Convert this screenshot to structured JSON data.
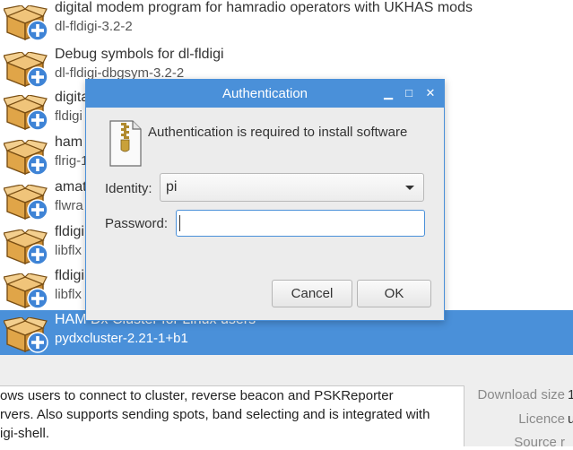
{
  "packages": [
    {
      "name": "digital modem program for hamradio operators with UKHAS mods",
      "id": "dl-fldigi-3.2-2",
      "selected": false
    },
    {
      "name": "Debug symbols for dl-fldigi",
      "id": "dl-fldigi-dbgsym-3.2-2",
      "selected": false
    },
    {
      "name": "digita",
      "id": "fldigi",
      "selected": false
    },
    {
      "name": "ham",
      "id": "flrig-1",
      "selected": false
    },
    {
      "name": "amat",
      "id": "flwra",
      "selected": false
    },
    {
      "name": "fldigi",
      "id": "libflx",
      "selected": false
    },
    {
      "name": "fldigi",
      "id": "libflx",
      "selected": false
    },
    {
      "name": "HAM Dx Cluster for Linux users",
      "id": "pydxcluster-2.21-1+b1",
      "selected": true
    }
  ],
  "description": {
    "lines": [
      "ows users to connect to cluster, reverse beacon and PSKReporter",
      "rvers. Also supports sending spots, band selecting and is integrated with",
      "igi-shell."
    ]
  },
  "details": {
    "download_size_label": "Download size",
    "download_size_value": "1",
    "licence_label": "Licence",
    "licence_value": "u",
    "source_label": "Source r"
  },
  "dialog": {
    "title": "Authentication",
    "minimize_glyph": "▁",
    "maximize_glyph": "□",
    "close_glyph": "✕",
    "message": "Authentication is required to install software",
    "identity_label": "Identity:",
    "identity_value": "pi",
    "password_label": "Password:",
    "password_value": "",
    "cancel_label": "Cancel",
    "ok_label": "OK"
  },
  "icons": {
    "package": "package-install-icon",
    "document": "zip-document-icon"
  },
  "colors": {
    "accent": "#4a90d9",
    "dialog_bg": "#ececec",
    "package_box": "#e3a542"
  }
}
